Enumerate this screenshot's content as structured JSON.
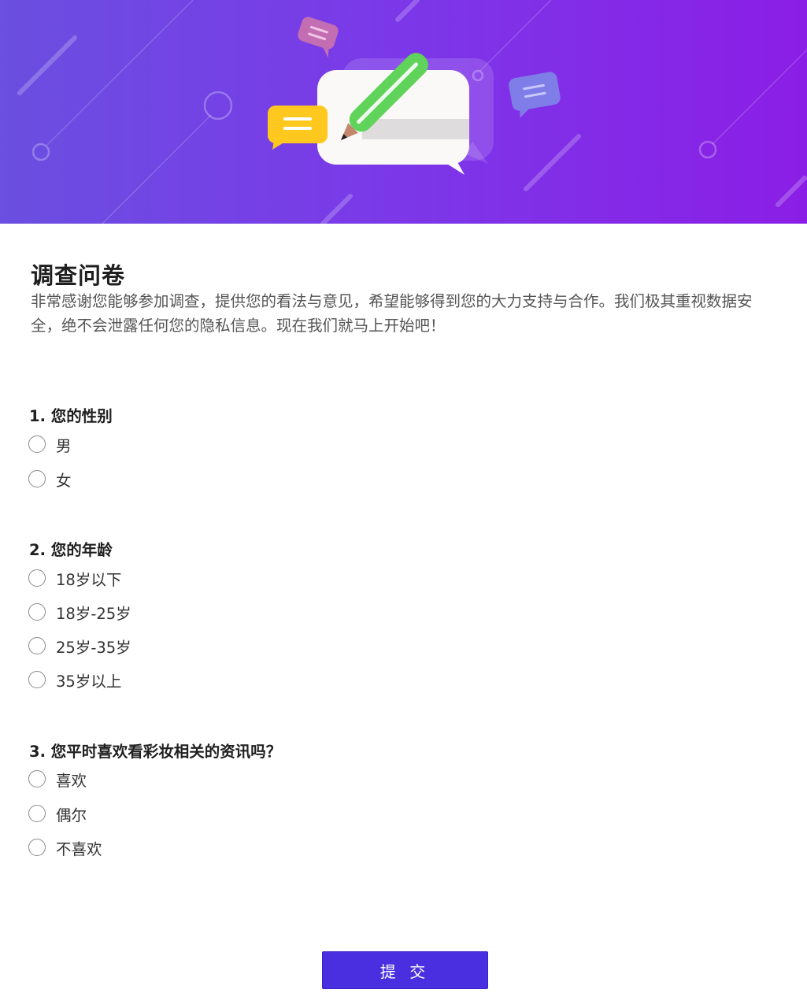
{
  "survey": {
    "title": "调查问卷",
    "intro": "非常感谢您能够参加调查，提供您的看法与意见，希望能够得到您的大力支持与合作。我们极其重视数据安全，绝不会泄露任何您的隐私信息。现在我们就马上开始吧！"
  },
  "questions": [
    {
      "label": "1. 您的性别",
      "options": [
        "男",
        "女"
      ]
    },
    {
      "label": "2. 您的年龄",
      "options": [
        "18岁以下",
        "18岁-25岁",
        "25岁-35岁",
        "35岁以上"
      ]
    },
    {
      "label": "3. 您平时喜欢看彩妆相关的资讯吗？",
      "options": [
        "喜欢",
        "偶尔",
        "不喜欢"
      ]
    }
  ],
  "submit": {
    "label": "提 交"
  },
  "colors": {
    "banner_start": "#6a4fe0",
    "banner_end": "#8b1ee6",
    "submit_bg": "#4a2fe0",
    "pencil_green": "#5fd35a",
    "yellow_bubble": "#ffc81e"
  }
}
